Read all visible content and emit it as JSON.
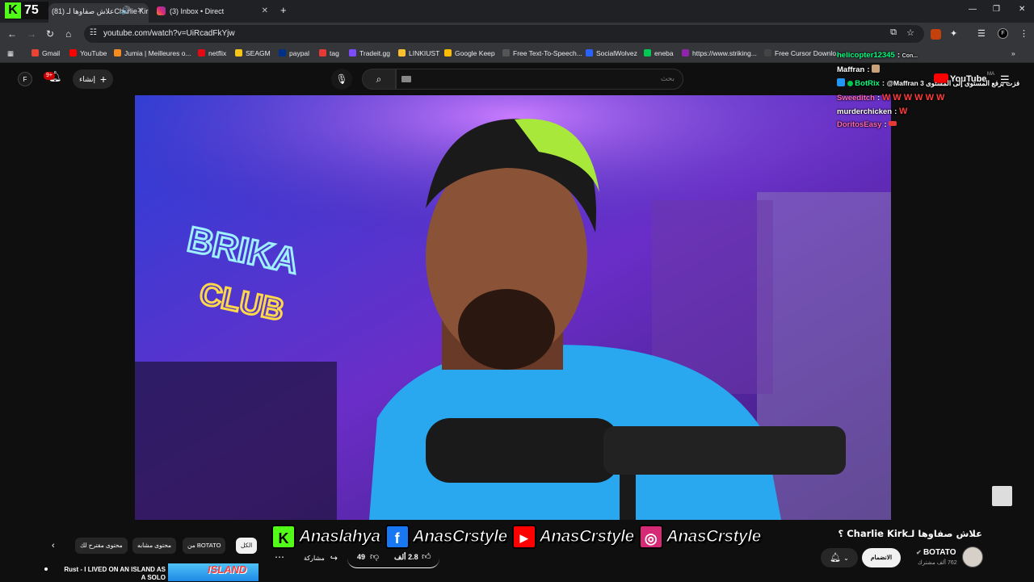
{
  "browser": {
    "badge_count": "75",
    "tabs": [
      {
        "title": "(81) علاش صفاوها لـCharlie Kirk",
        "active": true
      },
      {
        "title": "(3) Inbox • Direct",
        "active": false
      }
    ],
    "new_tab": "+",
    "url": "youtube.com/watch?v=UiRcadFkYjw",
    "bookmarks": [
      {
        "label": "Gmail",
        "color": "#ea4335"
      },
      {
        "label": "YouTube",
        "color": "#ff0000"
      },
      {
        "label": "Jumia | Meilleures o...",
        "color": "#f68b1e"
      },
      {
        "label": "netflix",
        "color": "#e50914"
      },
      {
        "label": "SEAGM",
        "color": "#f5c518"
      },
      {
        "label": "paypal",
        "color": "#003087"
      },
      {
        "label": "tag",
        "color": "#e53935"
      },
      {
        "label": "Tradeit.gg",
        "color": "#7c4dff"
      },
      {
        "label": "LINKIUST",
        "color": "#fbc02d"
      },
      {
        "label": "Google Keep",
        "color": "#fbbc04"
      },
      {
        "label": "Free Text-To-Speech...",
        "color": "#555555"
      },
      {
        "label": "SocialWolvez",
        "color": "#2962ff"
      },
      {
        "label": "eneba",
        "color": "#00c853"
      },
      {
        "label": "https://www.striking...",
        "color": "#8e24aa"
      },
      {
        "label": "Free Cursor Downlo...",
        "color": "#444444"
      }
    ]
  },
  "youtube": {
    "avatar_letter": "F",
    "notif_badge": "9+",
    "create_label": "إنشاء",
    "search_placeholder": "بحث",
    "logo_text": "YouTube",
    "country": "MA"
  },
  "chat": [
    {
      "user": "helicopter12345",
      "msg": "Con...",
      "color": "#00ff7f"
    },
    {
      "user": "Maffran",
      "msg": "",
      "color": "#ffffff"
    },
    {
      "user": "BotRix",
      "msg": "@Maffran 3 فزت برفع المستوى إلى المستوى",
      "color": "#00ff7f"
    },
    {
      "user": "Sweeditch",
      "msg": "W W W W W W",
      "color": "#ff69b4"
    },
    {
      "user": "murderchicken",
      "msg": "W",
      "color": "#ffffff"
    },
    {
      "user": "DoritosEasy",
      "msg": "",
      "color": "#ff69b4"
    }
  ],
  "socials": [
    {
      "platform": "kick",
      "handle": "Anaslahya",
      "color": "#53fc18",
      "glyph": "K"
    },
    {
      "platform": "facebook",
      "handle": "AnasCrstyle",
      "color": "#1877f2",
      "glyph": "f"
    },
    {
      "platform": "youtube",
      "handle": "AnasCrstyle",
      "color": "#ff0000",
      "glyph": "▶"
    },
    {
      "platform": "instagram",
      "handle": "AnasCrstyle",
      "color": "#d62976",
      "glyph": "◎"
    }
  ],
  "video": {
    "title": "علاش صفاوها لـCharlie Kirk ؟",
    "channel": "BOTATO",
    "subs": "762 ألف مشترك",
    "join_label": "الانضمام",
    "likes": "2.8 ألف",
    "dislikes": "49",
    "share_label": "مشاركة"
  },
  "chips": [
    {
      "label": "الكل",
      "active": true
    },
    {
      "label": "من BOTATO",
      "active": false
    },
    {
      "label": "محتوى مشابه",
      "active": false
    },
    {
      "label": "محتوى مقترح لك",
      "active": false
    }
  ],
  "recommended": {
    "title": "Rust - I LIVED ON AN ISLAND AS A SOLO",
    "thumb_text": "ISLAND"
  }
}
